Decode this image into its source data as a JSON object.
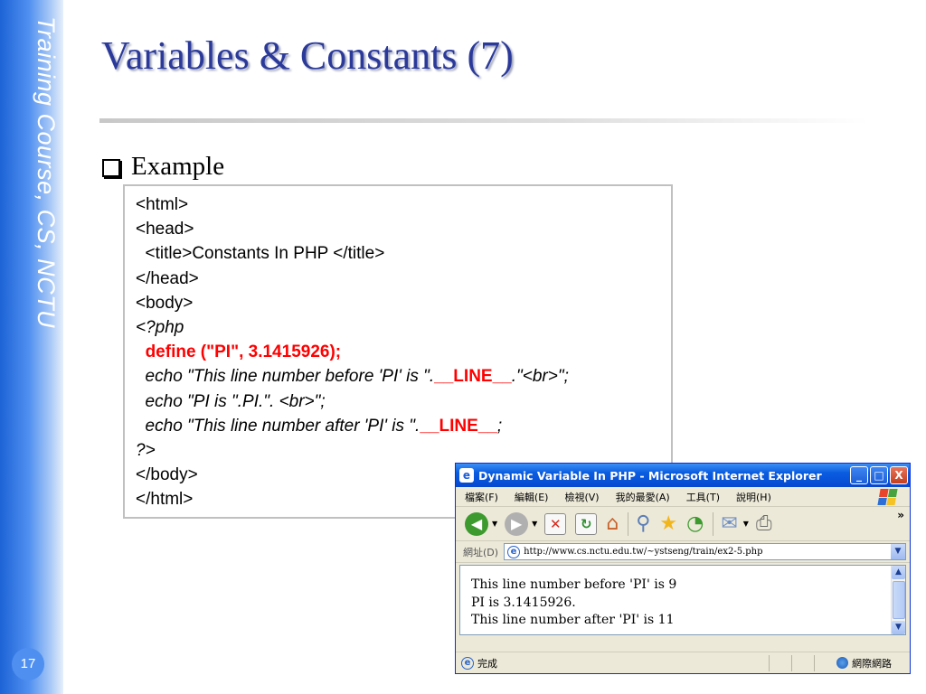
{
  "sidebar": {
    "title": "Training Course, CS, NCTU",
    "page_number": "17"
  },
  "slide": {
    "title": "Variables & Constants (7)",
    "bullet": "Example"
  },
  "code": {
    "lines": [
      {
        "text": "<html>"
      },
      {
        "text": "<head>"
      },
      {
        "text": "  <title>Constants In PHP </title>"
      },
      {
        "text": "</head>"
      },
      {
        "text": "<body>"
      },
      {
        "text": "<?php",
        "italic": true
      },
      {
        "red": "define (\"PI\", 3.1415926);",
        "text": "  "
      },
      {
        "text": "  echo \"This line number before 'PI' is \".",
        "red": "__LINE__",
        "after": ".\"<br>\";",
        "italic": true
      },
      {
        "text": "  echo \"PI is \".PI.\". <br>\";",
        "italic": true
      },
      {
        "text": "  echo \"This line number after 'PI' is \".",
        "red": "__LINE__",
        "after": ";",
        "italic": true
      },
      {
        "text": "?>",
        "italic": true
      },
      {
        "text": "</body>"
      },
      {
        "text": "</html>"
      }
    ]
  },
  "browser": {
    "title": "Dynamic Variable In PHP - Microsoft Internet Explorer",
    "title_icon": "e",
    "min_label": "_",
    "max_label": "□",
    "close_label": "X",
    "menus": [
      "檔案(F)",
      "編輯(E)",
      "檢視(V)",
      "我的最愛(A)",
      "工具(T)",
      "說明(H)"
    ],
    "toolbar_more": "»",
    "address_label": "網址(D)",
    "url": "http://www.cs.nctu.edu.tw/~ystseng/train/ex2-5.php",
    "output_lines": [
      "This line number before 'PI' is 9",
      "PI is 3.1415926.",
      "This line number after 'PI' is 11"
    ],
    "status_text": "完成",
    "zone_text": "網際網路",
    "colors": {
      "titlebar": "#0a5ce0",
      "back": "#3c9a2e",
      "forward": "#b0b0b0"
    }
  }
}
